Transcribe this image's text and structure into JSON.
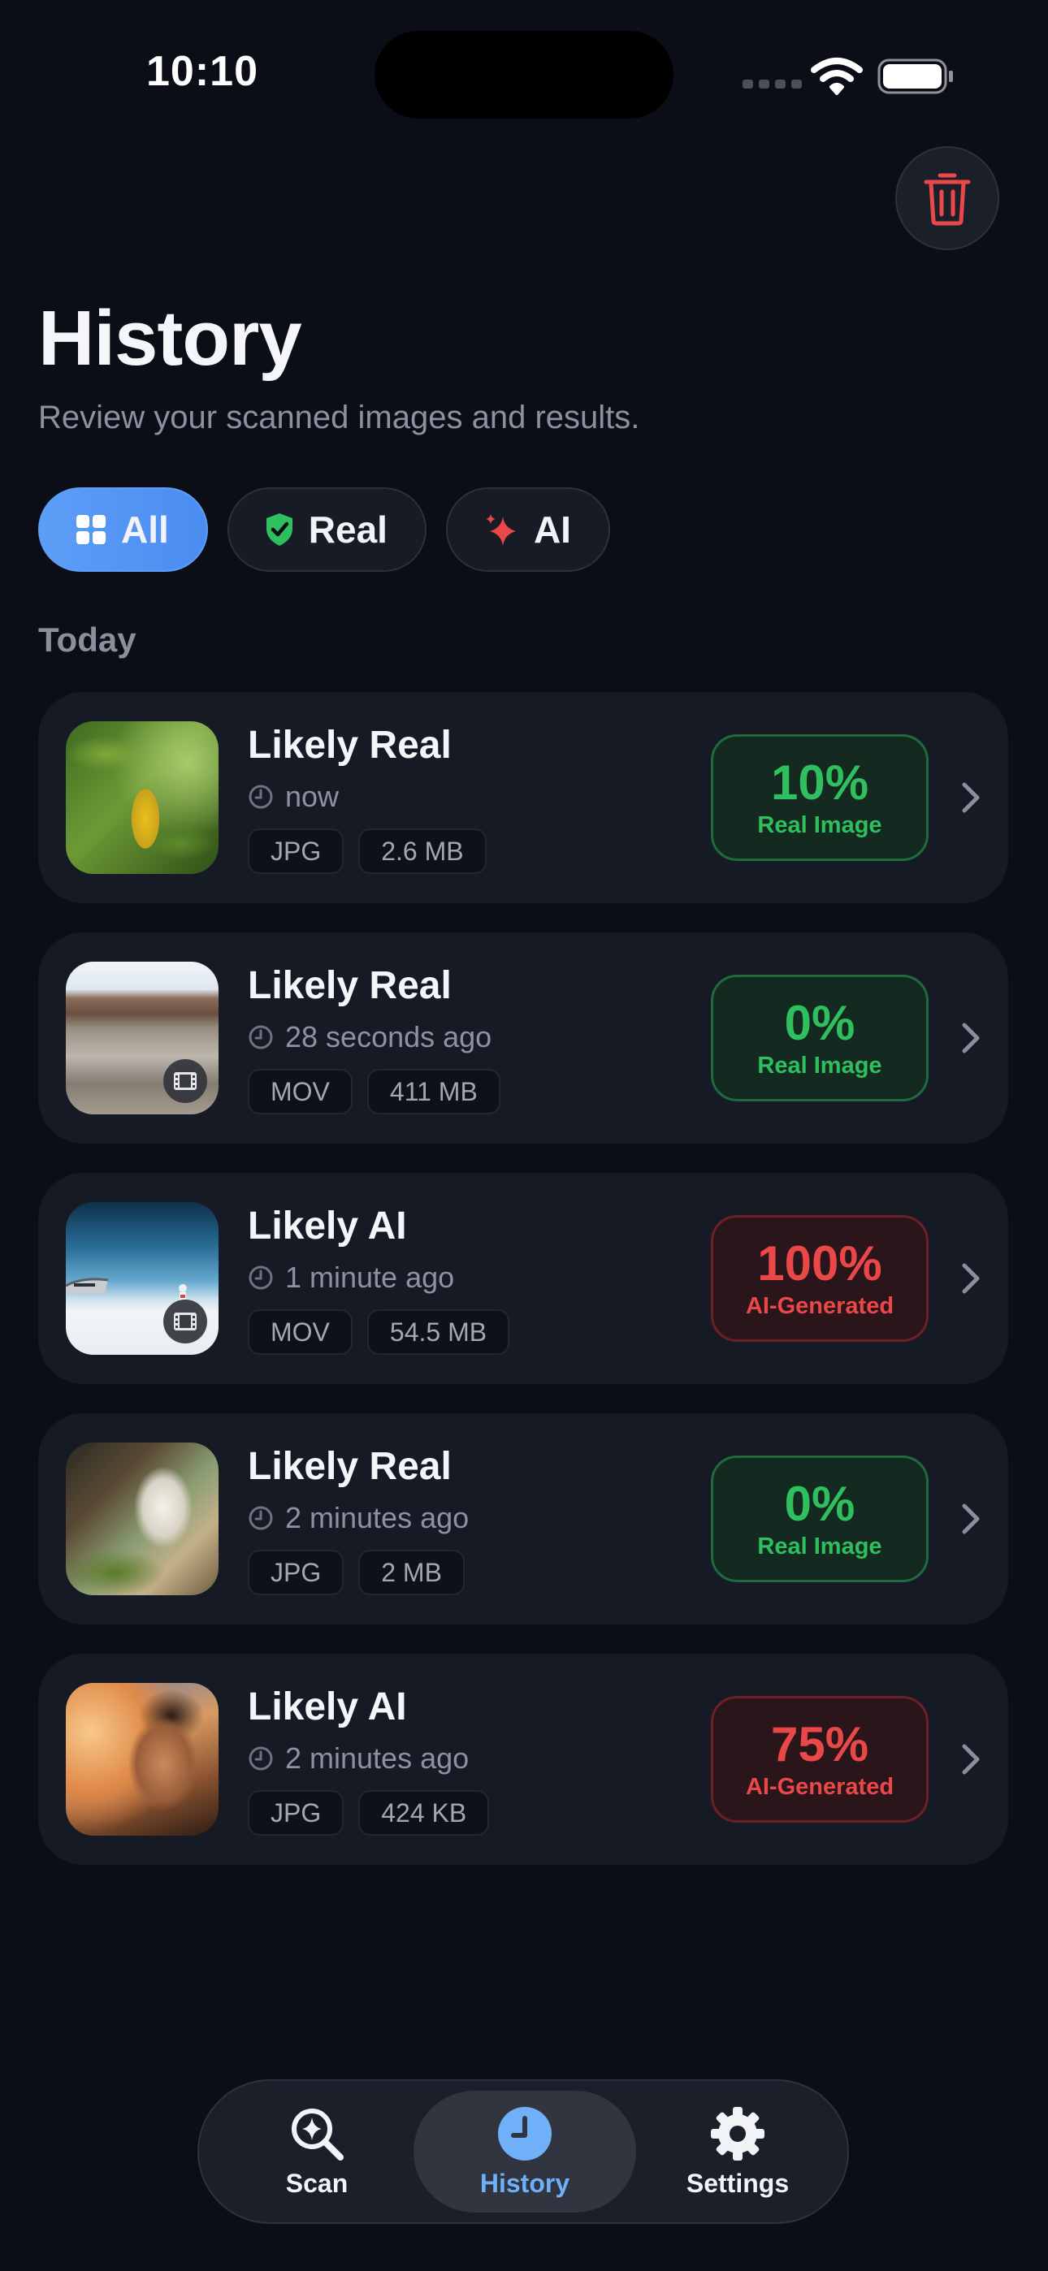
{
  "status": {
    "time": "10:10"
  },
  "header": {
    "title": "History",
    "subtitle": "Review your scanned images and results.",
    "trash_icon": "trash-icon"
  },
  "filters": [
    {
      "label": "All",
      "icon": "grid-icon",
      "active": true
    },
    {
      "label": "Real",
      "icon": "shield-check-icon",
      "active": false
    },
    {
      "label": "AI",
      "icon": "sparkle-icon",
      "active": false
    }
  ],
  "section": {
    "label": "Today"
  },
  "items": [
    {
      "title": "Likely Real",
      "time": "now",
      "format": "JPG",
      "size": "2.6 MB",
      "percent": "10%",
      "verdict": "Real Image",
      "kind": "real",
      "video": false
    },
    {
      "title": "Likely Real",
      "time": "28 seconds ago",
      "format": "MOV",
      "size": "411 MB",
      "percent": "0%",
      "verdict": "Real Image",
      "kind": "real",
      "video": true
    },
    {
      "title": "Likely AI",
      "time": "1 minute ago",
      "format": "MOV",
      "size": "54.5 MB",
      "percent": "100%",
      "verdict": "AI-Generated",
      "kind": "ai",
      "video": true
    },
    {
      "title": "Likely Real",
      "time": "2 minutes ago",
      "format": "JPG",
      "size": "2 MB",
      "percent": "0%",
      "verdict": "Real Image",
      "kind": "real",
      "video": false
    },
    {
      "title": "Likely AI",
      "time": "2 minutes ago",
      "format": "JPG",
      "size": "424 KB",
      "percent": "75%",
      "verdict": "AI-Generated",
      "kind": "ai",
      "video": false
    }
  ],
  "tabbar": {
    "scan": "Scan",
    "history": "History",
    "settings": "Settings",
    "active": "history"
  },
  "colors": {
    "accent": "#5d9ef7",
    "real": "#2fbf5e",
    "ai": "#ea4848",
    "background": "#0b0e17"
  }
}
